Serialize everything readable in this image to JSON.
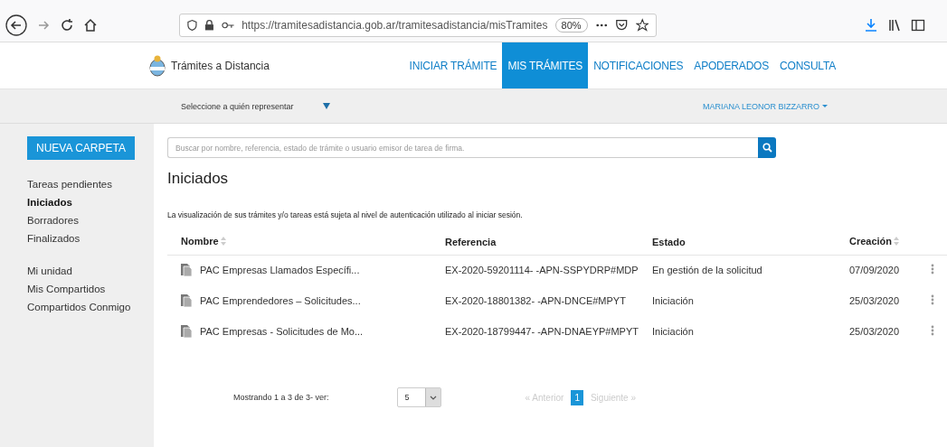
{
  "browser": {
    "url": "https://tramitesadistancia.gob.ar/tramitesadistancia/misTramites",
    "zoom": "80%"
  },
  "site": {
    "title": "Trámites a Distancia",
    "tabs": [
      {
        "label": "INICIAR TRÁMITE",
        "selected": false
      },
      {
        "label": "MIS TRÁMITES",
        "selected": true
      },
      {
        "label": "NOTIFICACIONES",
        "selected": false
      },
      {
        "label": "APODERADOS",
        "selected": false
      },
      {
        "label": "CONSULTA",
        "selected": false
      }
    ]
  },
  "subbar": {
    "represent": "Seleccione a quién representar",
    "user": "MARIANA LEONOR BIZZARRO"
  },
  "sidebar": {
    "button": "NUEVA CARPETA",
    "groups": [
      [
        {
          "label": "Tareas pendientes",
          "selected": false
        },
        {
          "label": "Iniciados",
          "selected": true
        },
        {
          "label": "Borradores",
          "selected": false
        },
        {
          "label": "Finalizados",
          "selected": false
        }
      ],
      [
        {
          "label": "Mi unidad",
          "selected": false
        },
        {
          "label": "Mis Compartidos",
          "selected": false
        },
        {
          "label": "Compartidos Conmigo",
          "selected": false
        }
      ]
    ]
  },
  "search": {
    "placeholder": "Buscar por nombre, referencia, estado de trámite o usuario emisor de tarea de firma."
  },
  "heading": "Iniciados",
  "notice": "La visualización de sus trámites y/o tareas está sujeta al nivel de autenticación utilizado al iniciar sesión.",
  "table": {
    "columns": [
      {
        "label": "Nombre",
        "sortable": true
      },
      {
        "label": "Referencia",
        "sortable": false
      },
      {
        "label": "Estado",
        "sortable": false
      },
      {
        "label": "Creación",
        "sortable": true
      }
    ],
    "rows": [
      [
        "PAC Empresas Llamados Específi...",
        "EX-2020-59201114- -APN-SSPYDRP#MDP",
        "En gestión de la solicitud",
        "07/09/2020"
      ],
      [
        "PAC Emprendedores – Solicitudes...",
        "EX-2020-18801382- -APN-DNCE#MPYT",
        "Iniciación",
        "25/03/2020"
      ],
      [
        "PAC Empresas - Solicitudes de Mo...",
        "EX-2020-18799447- -APN-DNAEYP#MPYT",
        "Iniciación",
        "25/03/2020"
      ]
    ]
  },
  "pagination": {
    "summary": "Mostrando 1 a 3 de 3- ver:",
    "page_size": "5",
    "prev": "« Anterior",
    "next": "Siguiente »",
    "pages": [
      {
        "label": "1",
        "selected": true
      }
    ]
  }
}
